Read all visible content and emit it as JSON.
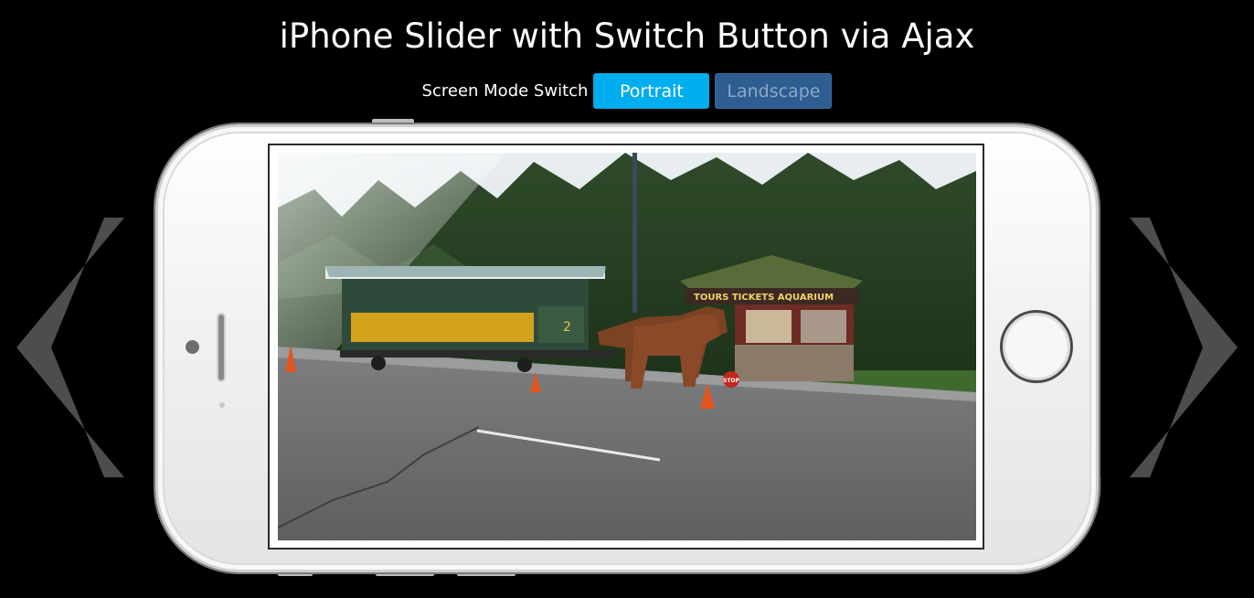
{
  "page": {
    "title": "iPhone Slider with Switch Button via Ajax"
  },
  "mode_switch": {
    "label": "Screen Mode Switch",
    "options": [
      {
        "label": "Portrait",
        "active": true
      },
      {
        "label": "Landscape",
        "active": false
      }
    ]
  },
  "slider": {
    "prev_icon": "chevron-left-icon",
    "next_icon": "chevron-right-icon",
    "slide_sign_text": "TOURS   TICKETS   AQUARIUM",
    "stop_sign_text": "STOP",
    "tram_number": "2"
  },
  "colors": {
    "page_background": "#000000",
    "portrait_button": "#00aeef",
    "landscape_button": "#2d5d91",
    "arrow": "#4a4a4a",
    "phone_body": "#f2f2f2"
  }
}
